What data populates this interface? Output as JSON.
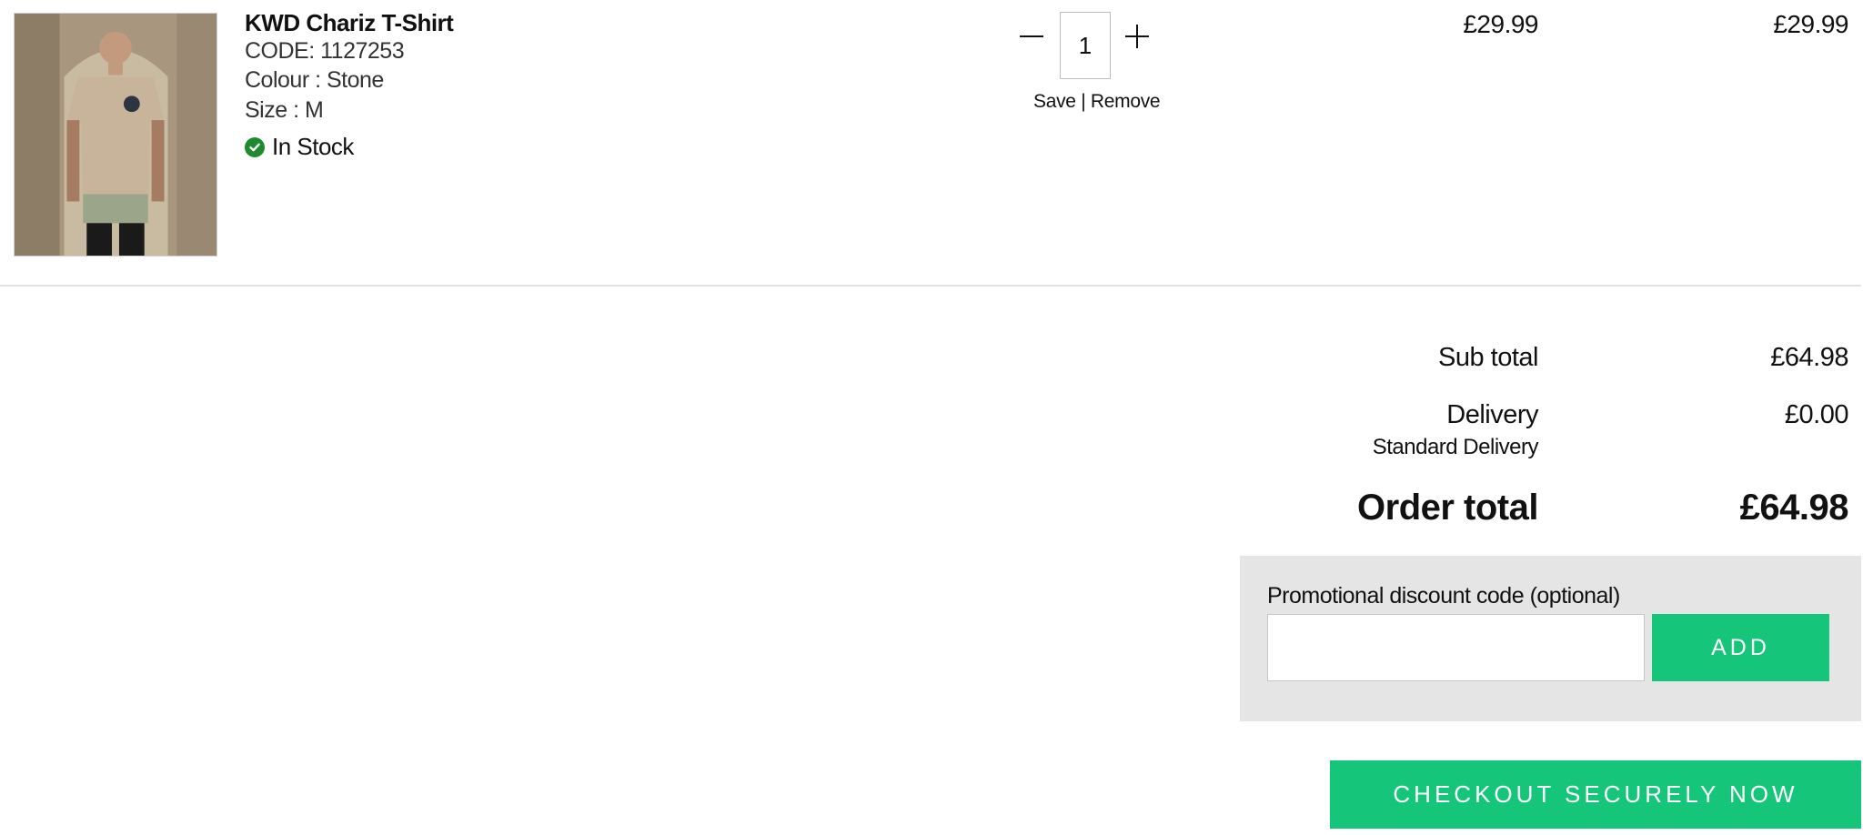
{
  "item": {
    "name": "KWD Chariz T-Shirt",
    "code": "CODE: 1127253",
    "colour": "Colour : Stone",
    "size": "Size : M",
    "stock": "In Stock",
    "stock_color": "#1f8a2d",
    "quantity": "1",
    "save_label": "Save",
    "separator": " | ",
    "remove_label": "Remove",
    "unit_price": "£29.99",
    "line_total": "£29.99"
  },
  "summary": {
    "subtotal_label": "Sub total",
    "subtotal_value": "£64.98",
    "delivery_label": "Delivery",
    "delivery_value": "£0.00",
    "delivery_method": "Standard Delivery",
    "order_total_label": "Order total",
    "order_total_value": "£64.98"
  },
  "promo": {
    "label": "Promotional discount code (optional)",
    "input_value": "",
    "add_label": "ADD"
  },
  "checkout": {
    "label": "CHECKOUT SECURELY NOW"
  },
  "colors": {
    "accent": "#15c57a",
    "panel": "#e5e5e5"
  }
}
